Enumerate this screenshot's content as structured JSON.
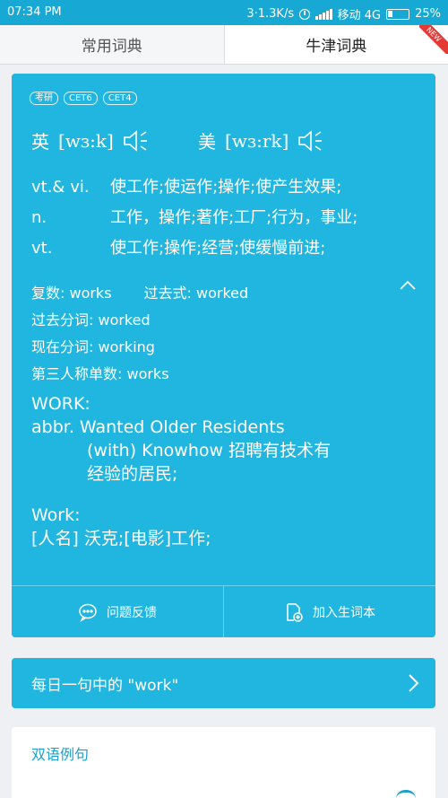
{
  "status_bar": {
    "time": "07:34 PM",
    "speed": "3·1.3K/s",
    "carrier": "移动 4G",
    "battery": "25%",
    "icons": [
      "clock-icon",
      "signal-icon",
      "battery-icon"
    ]
  },
  "tabs": [
    {
      "label": "常用词典",
      "active": false
    },
    {
      "label": "牛津词典",
      "active": true,
      "badge": "NEW"
    }
  ],
  "entry": {
    "tags": [
      "考研",
      "CET6",
      "CET4"
    ],
    "pron_uk": {
      "label": "英",
      "ipa": "[wɜ:k]"
    },
    "pron_us": {
      "label": "美",
      "ipa": "[wɜ:rk]"
    },
    "definitions": [
      {
        "pos": "vt.& vi.",
        "meaning": "使工作;使运作;操作;使产生效果;"
      },
      {
        "pos": "n.",
        "meaning": "工作，操作;著作;工厂;行为，事业;"
      },
      {
        "pos": "vt.",
        "meaning": "使工作;操作;经营;使缓慢前进;"
      }
    ],
    "forms": {
      "plural": "复数: works",
      "past": "过去式: worked",
      "past_participle": "过去分词: worked",
      "present_participle": "现在分词: working",
      "third_person": "第三人称单数: works"
    },
    "abbr_heading": "WORK:",
    "abbr_line1": "abbr. Wanted Older Residents",
    "abbr_line2": "(with) Knowhow 招聘有技术有",
    "abbr_line3": "经验的居民;",
    "name_heading": "Work:",
    "name_line": "[人名] 沃克;[电影]工作;"
  },
  "actions": {
    "feedback": "问题反馈",
    "add_vocab": "加入生词本"
  },
  "daily": {
    "label": "每日一句中的 \"work\""
  },
  "examples": {
    "title": "双语例句"
  },
  "colors": {
    "accent": "#20b6e0",
    "status_bar": "#17a8d4",
    "badge": "#e53935"
  }
}
